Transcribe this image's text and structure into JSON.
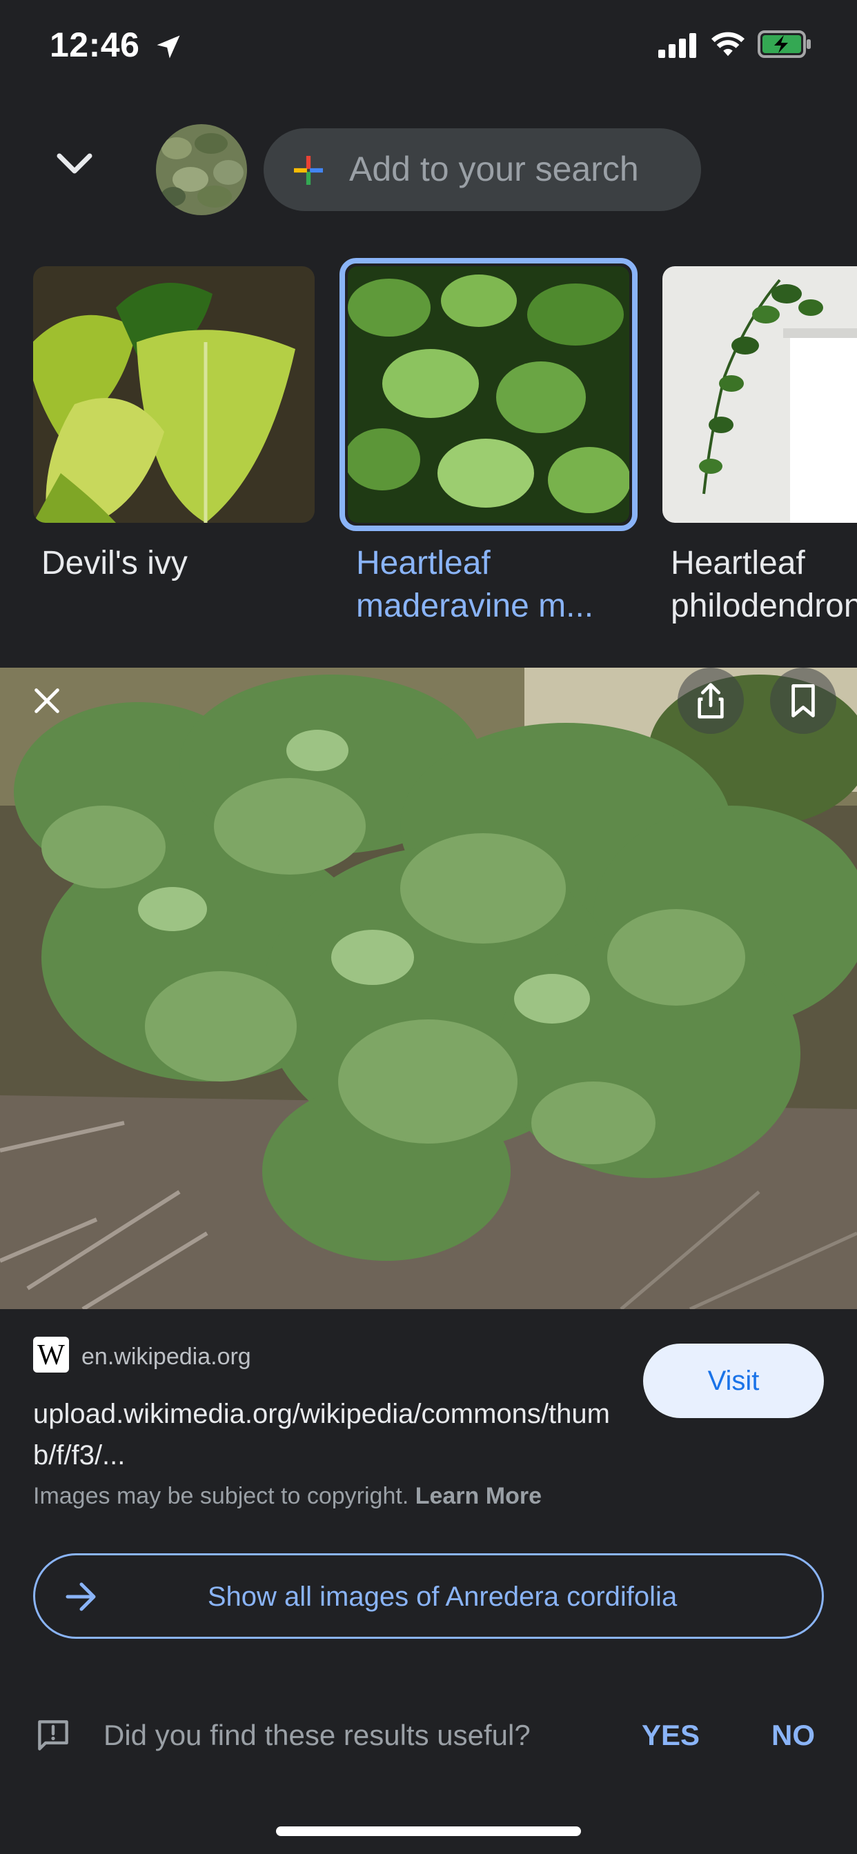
{
  "status_bar": {
    "time": "12:46",
    "battery_color": "#34a853"
  },
  "search": {
    "placeholder": "Add to your search"
  },
  "carousel": [
    {
      "label": "Devil's ivy",
      "selected": false
    },
    {
      "label": "Heartleaf maderavine m...",
      "selected": true
    },
    {
      "label": "Heartleaf philodendron",
      "selected": false
    }
  ],
  "result": {
    "source_domain": "en.wikipedia.org",
    "wiki_logo": "W",
    "visit_label": "Visit",
    "url": "upload.wikimedia.org/wikipedia/commons/thumb/f/f3/...",
    "copyright_text": "Images may be subject to copyright.",
    "learn_more": "Learn More",
    "show_all_label": "Show all images of Anredera cordifolia"
  },
  "feedback": {
    "question": "Did you find these results useful?",
    "yes": "YES",
    "no": "NO"
  },
  "colors": {
    "background": "#202124",
    "accent": "#8ab4f8",
    "visit_bg": "#e8f0fe"
  },
  "icons": [
    "location-arrow-icon",
    "signal-icon",
    "wifi-icon",
    "battery-charging-icon",
    "chevron-down-icon",
    "google-plus-icon",
    "close-icon",
    "share-icon",
    "bookmark-icon",
    "arrow-right-icon",
    "feedback-icon"
  ]
}
